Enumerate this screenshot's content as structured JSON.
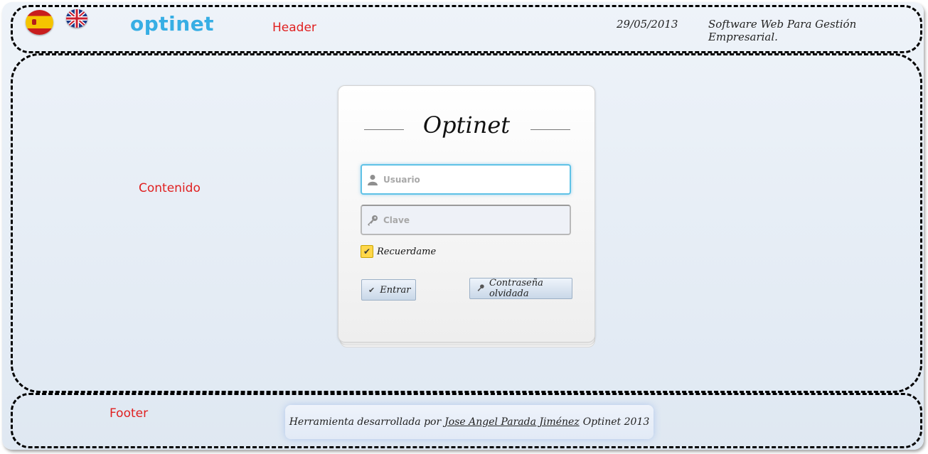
{
  "header": {
    "logo_text": "optinet",
    "date": "29/05/2013",
    "tagline": "Software Web Para Gestión Empresarial.",
    "languages": [
      {
        "code": "es",
        "icon": "spain-flag-icon"
      },
      {
        "code": "en",
        "icon": "uk-flag-icon"
      }
    ]
  },
  "region_labels": {
    "header": "Header",
    "content": "Contenido",
    "footer": "Footer"
  },
  "login": {
    "title": "Optinet",
    "username_placeholder": "Usuario",
    "password_placeholder": "Clave",
    "remember_label": "Recuerdame",
    "remember_checked": true,
    "enter_label": "Entrar",
    "forgot_label": "Contraseña olvidada"
  },
  "footer": {
    "prefix": "Herramienta desarrollada por",
    "author": "Jose Angel Parada Jiménez",
    "suffix": "Optinet 2013"
  },
  "colors": {
    "region_label": "#e02020",
    "logo": "#37aee4",
    "input_focus": "#5fc2e6",
    "checkbox": "#ffd74a"
  }
}
